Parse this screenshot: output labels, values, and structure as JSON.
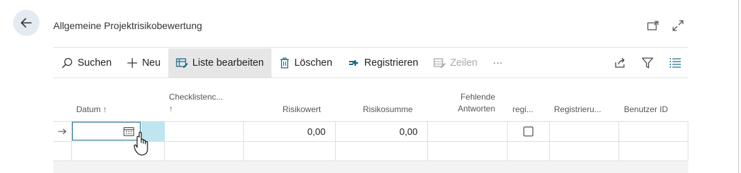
{
  "header": {
    "title": "Allgemeine Projektrisikobewertung"
  },
  "toolbar": {
    "search": "Suchen",
    "new": "Neu",
    "edit_list": "Liste bearbeiten",
    "delete": "Löschen",
    "register": "Registrieren",
    "lines": "Zeilen",
    "more": "···"
  },
  "columns": {
    "datum": "Datum ↑",
    "checkliste_line1": "Checklistenc...",
    "checkliste_line2": "↑",
    "risikowert": "Risikowert",
    "risikosumme": "Risikosumme",
    "fehlende_line1": "Fehlende",
    "fehlende_line2": "Antworten",
    "regi": "regi...",
    "registrieru": "Registrieru...",
    "benutzer": "Benutzer ID"
  },
  "rows": [
    {
      "risikowert": "0,00",
      "risikosumme": "0,00",
      "registered": false
    },
    {
      "risikowert": "",
      "risikosumme": ""
    }
  ],
  "colors": {
    "accent": "#1c6b8c",
    "active_cell_fill": "#bfe6f0",
    "toolbar_active": "#e6e6e6",
    "back_button": "#e3eaf2"
  },
  "icons": {
    "back": "arrow-left-icon",
    "open_new": "open-in-new-window-icon",
    "expand": "expand-icon",
    "search": "search-icon",
    "new": "plus-icon",
    "edit_list": "edit-list-icon",
    "delete": "trash-icon",
    "register": "register-icon",
    "lines": "lines-icon",
    "share": "share-icon",
    "filter": "filter-icon",
    "list_view": "list-view-icon",
    "calendar": "calendar-icon",
    "row_arrow": "row-arrow-icon",
    "cursor": "hand-cursor-icon"
  }
}
